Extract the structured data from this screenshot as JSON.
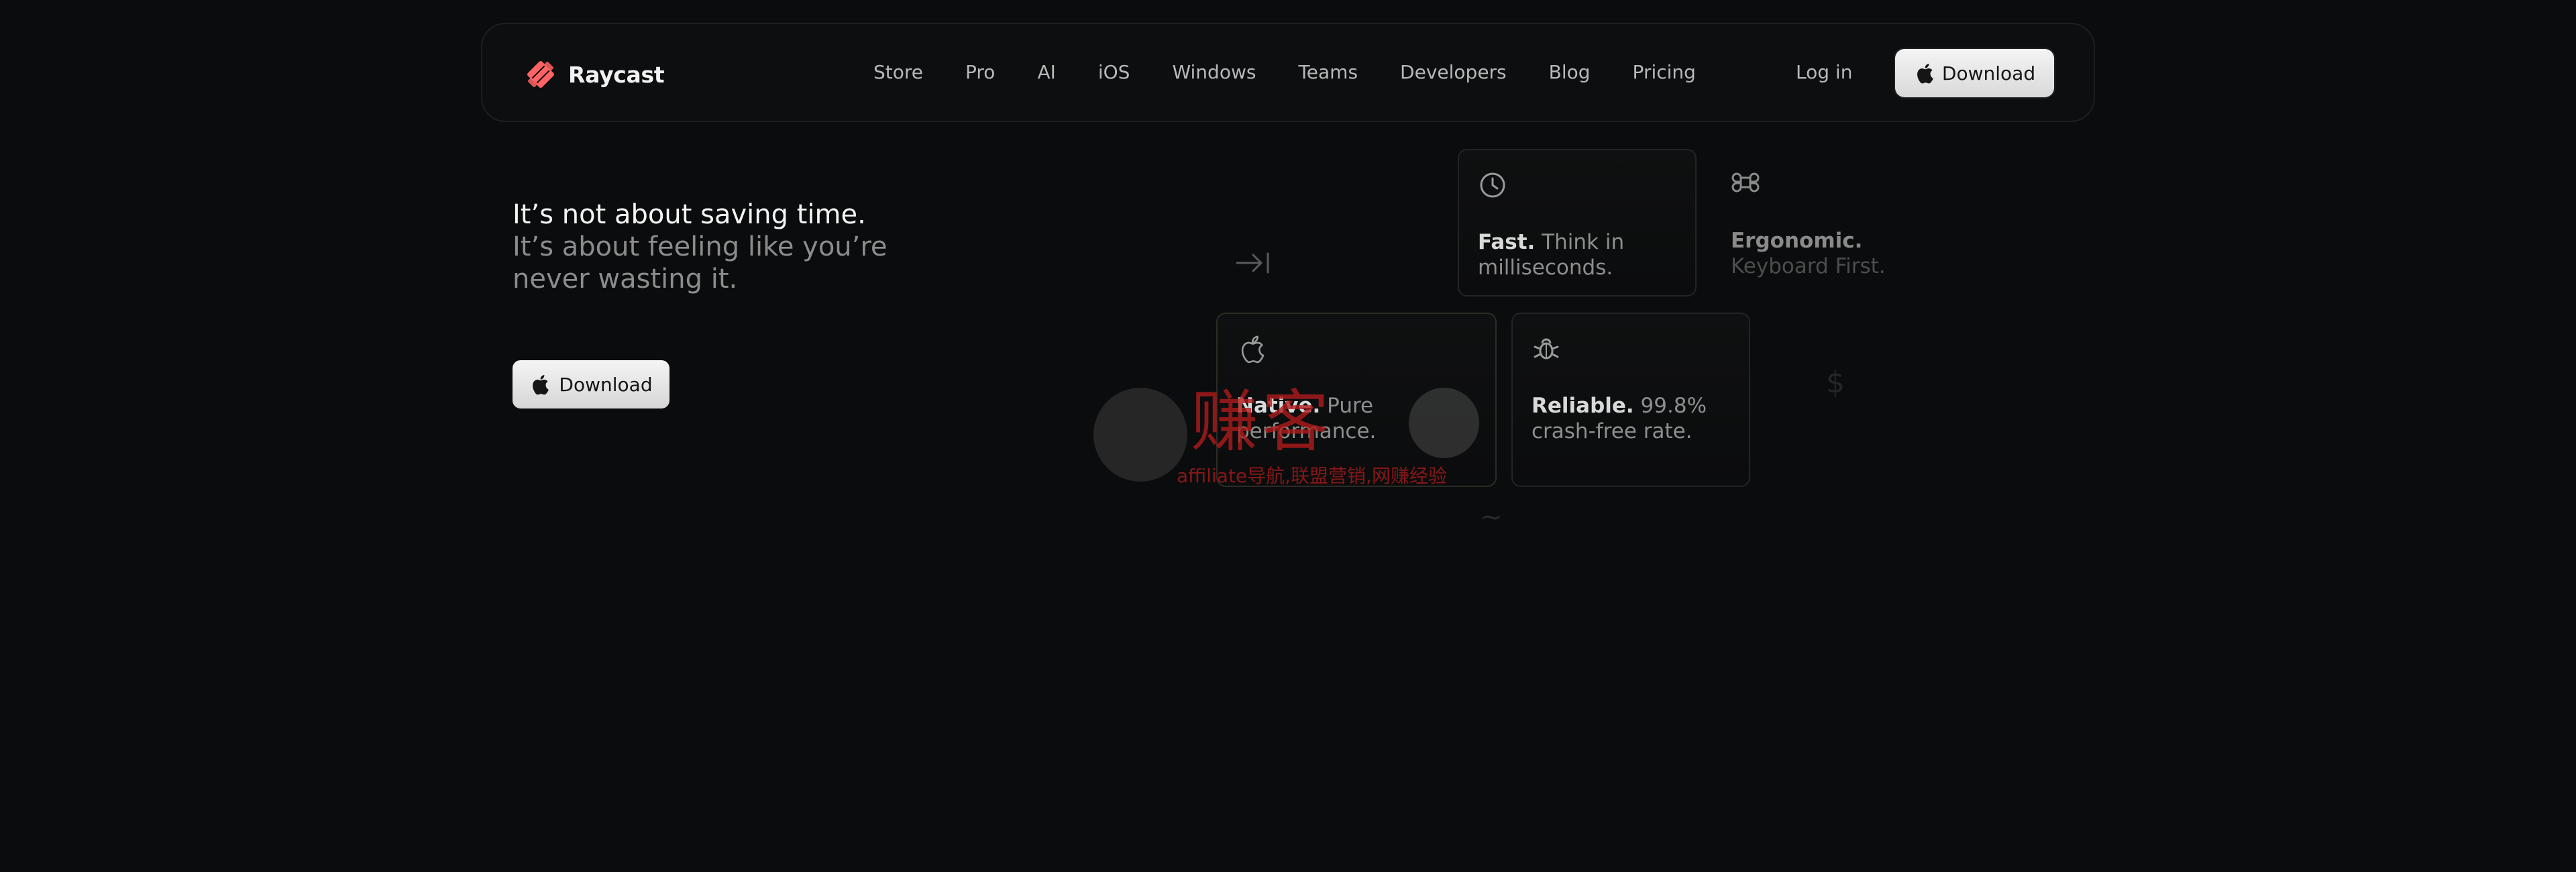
{
  "nav": {
    "brand": "Raycast",
    "items": [
      "Store",
      "Pro",
      "AI",
      "iOS",
      "Windows",
      "Teams",
      "Developers",
      "Blog",
      "Pricing"
    ],
    "login": "Log in",
    "download": "Download"
  },
  "hero": {
    "line1": "It’s not about saving time.",
    "line2": "It’s about feeling like you’re never wasting it.",
    "download": "Download"
  },
  "features": {
    "fast": {
      "bold": "Fast.",
      "text": " Think in milliseconds.",
      "icon": "clock-icon"
    },
    "ergonomic": {
      "bold": "Ergonomic.",
      "text": " Keyboard First.",
      "icon": "command-icon"
    },
    "native": {
      "bold": "Native.",
      "text": " Pure performance.",
      "icon": "apple-icon"
    },
    "reliable": {
      "bold": "Reliable.",
      "text": " 99.8% crash-free rate.",
      "icon": "bug-icon"
    }
  },
  "decor": {
    "dollar": "$",
    "tilde": "~"
  },
  "watermark": {
    "title": "赚客",
    "subtitle": "affiliate导航,联盟营销,网赚经验"
  },
  "colors": {
    "background": "#0b0c0d",
    "brand_red": "#ff6363",
    "button_bg": "#e8e8e8"
  }
}
